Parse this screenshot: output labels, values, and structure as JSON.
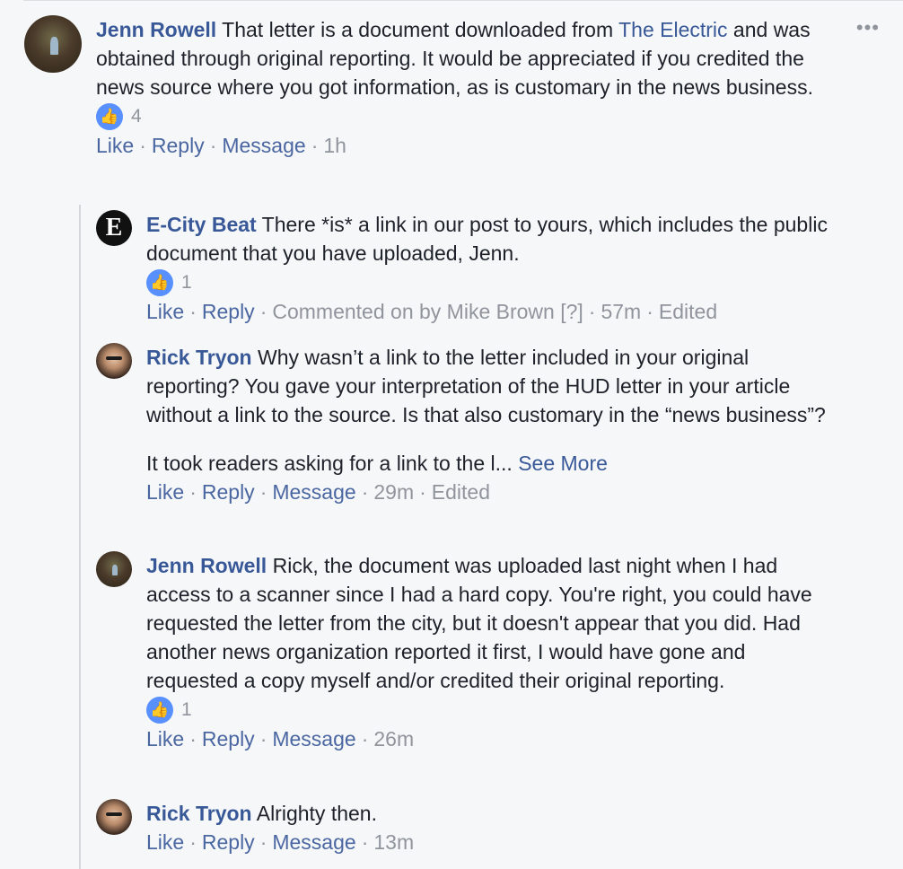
{
  "comments": [
    {
      "author": "Jenn Rowell",
      "text_before_link": " That letter is a document downloaded from ",
      "link": "The Electric",
      "text_after_link": " and was obtained through original reporting. It would be appreciated if you credited the news source where you got information, as is customary in the news business.",
      "like_count": "4",
      "actions": [
        "Like",
        "Reply",
        "Message"
      ],
      "time": "1h"
    },
    {
      "author": "E-City Beat",
      "avatar_letter": "E",
      "text": " There *is* a link in our post to yours, which includes the public document that you have uploaded, Jenn.",
      "like_count": "1",
      "actions": [
        "Like",
        "Reply"
      ],
      "meta": "Commented on by Mike Brown [?]",
      "time": "57m",
      "edited": "Edited"
    },
    {
      "author": "Rick Tryon",
      "text": " Why wasn’t a link to the letter included in your original reporting? You gave your interpretation of the HUD letter in your article without a link to the source. Is that also customary in the “news business”?",
      "text2": "It took readers asking for a link to the l...",
      "see_more": "See More",
      "actions": [
        "Like",
        "Reply",
        "Message"
      ],
      "time": "29m",
      "edited": "Edited"
    },
    {
      "author": "Jenn Rowell",
      "text": " Rick, the document was uploaded last night when I had access to a scanner since I had a hard copy. You're right, you could have requested the letter from the city, but it doesn't appear that you did. Had another news organization reported it first, I would have gone and requested a copy myself and/or credited their original reporting.",
      "like_count": "1",
      "actions": [
        "Like",
        "Reply",
        "Message"
      ],
      "time": "26m"
    },
    {
      "author": "Rick Tryon",
      "text": " Alrighty then.",
      "actions": [
        "Like",
        "Reply",
        "Message"
      ],
      "time": "13m"
    }
  ],
  "separator": "·",
  "more_menu": "•••",
  "thumb_glyph": "👍",
  "colors": {
    "link": "#385898",
    "meta": "#90949c",
    "like_badge": "#5890ff"
  }
}
